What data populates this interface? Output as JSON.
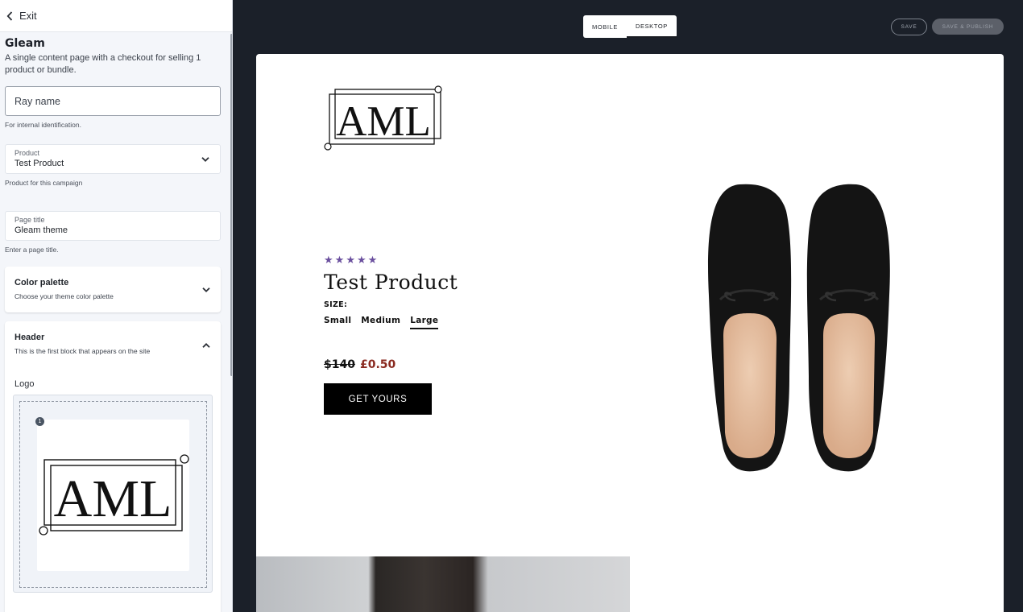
{
  "panel": {
    "exit_label": "Exit",
    "theme_title": "Gleam",
    "theme_description": "A single content page with a checkout for selling 1 product or bundle.",
    "ray_name_placeholder": "Ray name",
    "ray_name_helper": "For internal identification.",
    "product_label": "Product",
    "product_value": "Test Product",
    "product_helper": "Product for this campaign",
    "page_title_label": "Page title",
    "page_title_value": "Gleam theme",
    "page_title_helper": "Enter a page title.",
    "color_palette_title": "Color palette",
    "color_palette_desc": "Choose your theme color palette",
    "header_title": "Header",
    "header_desc": "This is the first block that appears on the site",
    "logo_label": "Logo",
    "logo_badge": "1",
    "logo_text": "AML"
  },
  "topbar": {
    "mobile_label": "MOBILE",
    "desktop_label": "DESKTOP",
    "active_view": "desktop",
    "save_label": "SAVE",
    "publish_label": "SAVE & PUBLISH"
  },
  "preview": {
    "logo_text": "AML",
    "rating_stars": 5,
    "product_name": "Test Product",
    "size_label": "SIZE:",
    "sizes": [
      "Small",
      "Medium",
      "Large"
    ],
    "selected_size": "Large",
    "price_old": "$140",
    "price_new": "£0.50",
    "cta_label": "GET YOURS"
  },
  "colors": {
    "app_background": "#1b2029",
    "star": "#6a4f9e",
    "sale_price": "#8a2a20",
    "cta_background": "#000000"
  }
}
